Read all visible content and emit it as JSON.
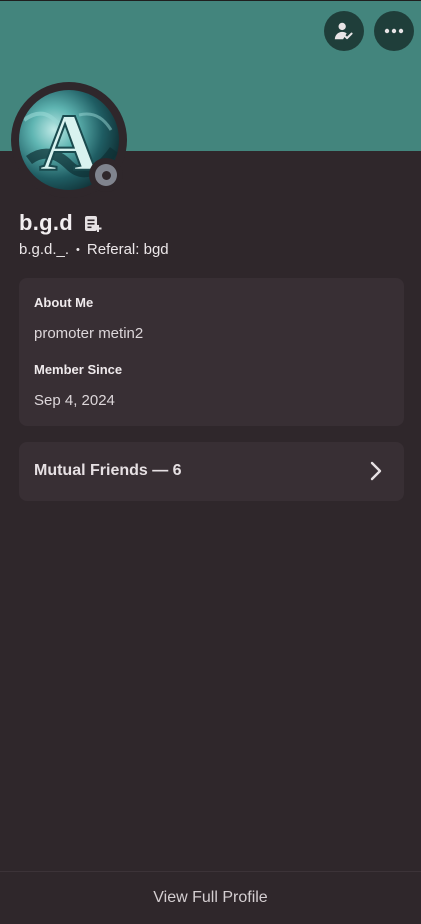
{
  "header": {
    "buttons": [
      {
        "icon": "add-friend-icon"
      },
      {
        "icon": "more-options-icon"
      }
    ],
    "banner_color": "#43857d"
  },
  "profile": {
    "avatar_letter": "A",
    "status": "offline",
    "status_color": "#80848e",
    "display_name": "b.g.d",
    "username": "b.g.d._.",
    "separator": "•",
    "referral": "Referal: bgd"
  },
  "about": {
    "title": "About Me",
    "text": "promoter metin2",
    "member_since_title": "Member Since",
    "member_since": "Sep 4, 2024"
  },
  "mutual": {
    "label": "Mutual Friends — 6"
  },
  "footer": {
    "label": "View Full Profile"
  }
}
